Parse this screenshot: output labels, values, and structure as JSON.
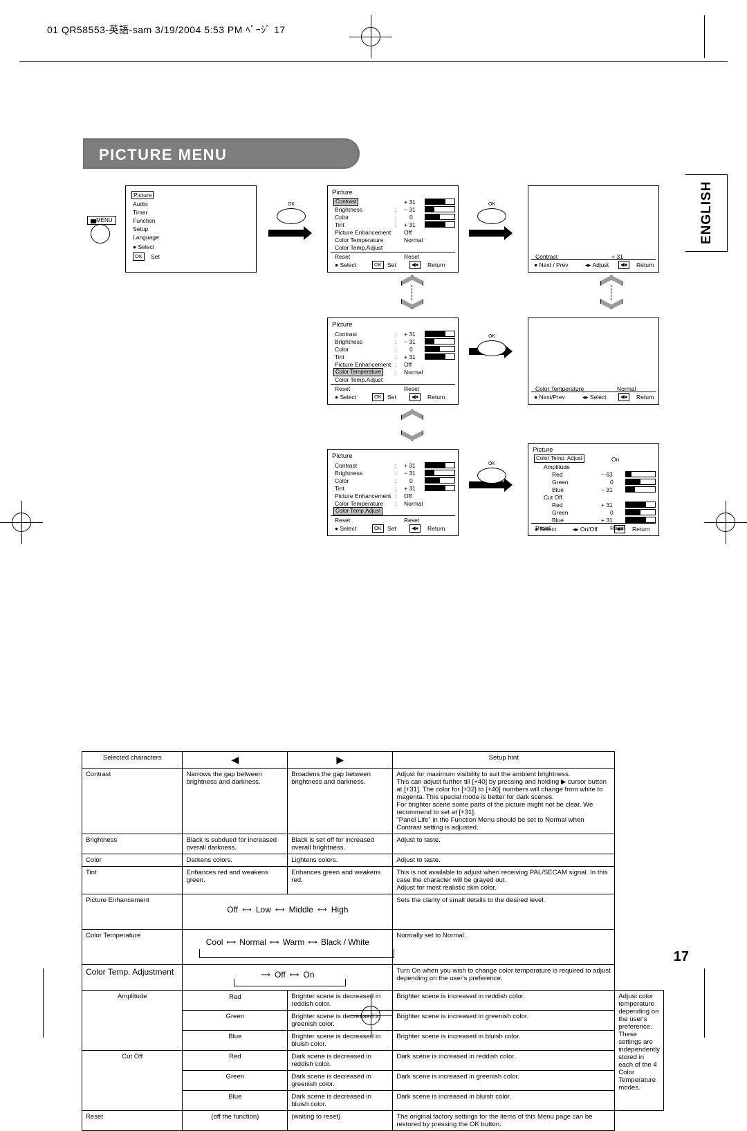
{
  "header": {
    "text": "01 QR58553-英語-sam 3/19/2004 5:53 PM ﾍﾟｰｼﾞ 17"
  },
  "title": "PICTURE MENU",
  "language_tab": "ENGLISH",
  "page_number": "17",
  "osd": {
    "menu_button_label": "MENU",
    "panel1": {
      "title": "Picture",
      "items": [
        "Picture",
        "Audio",
        "Timer",
        "Function",
        "Setup",
        "Language"
      ],
      "footer_select": "Select",
      "footer_ok": "OK",
      "footer_set": "Set"
    },
    "panel2": {
      "title": "Picture",
      "rows": [
        {
          "label": "Contrast",
          "value": "+ 31",
          "bar": 70,
          "highlight": true
        },
        {
          "label": "Brightness",
          "value": "− 31",
          "bar": 30
        },
        {
          "label": "Color",
          "value": "0",
          "bar": 50
        },
        {
          "label": "Tint",
          "value": "+ 31",
          "bar": 70
        },
        {
          "label": "Picture Enhancement",
          "value": "Off"
        },
        {
          "label": "Color Temperature",
          "value": "Normal"
        },
        {
          "label": "Color Temp.Adjust",
          "value": ""
        },
        {
          "label": "Reset",
          "value": "Reset"
        }
      ],
      "footer": [
        "Select",
        "OK",
        "Set",
        "Return"
      ]
    },
    "panel3": {
      "rows": [
        {
          "label": "Contrast",
          "value": "+ 31"
        }
      ],
      "footer": [
        "Next / Prev",
        "Adjust",
        "Return"
      ]
    },
    "panel4": {
      "title": "Picture",
      "rows": [
        {
          "label": "Contrast",
          "value": "+ 31",
          "bar": 70
        },
        {
          "label": "Brightness",
          "value": "− 31",
          "bar": 30
        },
        {
          "label": "Color",
          "value": "0",
          "bar": 50
        },
        {
          "label": "Tint",
          "value": "+ 31",
          "bar": 70
        },
        {
          "label": "Picture Enhancement",
          "value": "Off"
        },
        {
          "label": "Color Temperature",
          "value": "Normal",
          "highlight": true
        },
        {
          "label": "Color Temp.Adjust",
          "value": ""
        },
        {
          "label": "Reset",
          "value": "Reset"
        }
      ],
      "footer": [
        "Select",
        "OK",
        "Set",
        "Return"
      ]
    },
    "panel5": {
      "rows": [
        {
          "label": "Color Temperature",
          "value": "Normal"
        }
      ],
      "footer": [
        "Next/Prev",
        "Select",
        "Return"
      ]
    },
    "panel6": {
      "title": "Picture",
      "rows": [
        {
          "label": "Contrast",
          "value": "+ 31",
          "bar": 70
        },
        {
          "label": "Brightness",
          "value": "− 31",
          "bar": 30
        },
        {
          "label": "Color",
          "value": "0",
          "bar": 50
        },
        {
          "label": "Tint",
          "value": "+ 31",
          "bar": 70
        },
        {
          "label": "Picture Enhancement",
          "value": "Off"
        },
        {
          "label": "Color Temperature",
          "value": "Normal"
        },
        {
          "label": "Color Temp.Adjust",
          "value": "",
          "highlight": true
        },
        {
          "label": "Reset",
          "value": "Reset"
        }
      ],
      "footer": [
        "Select",
        "OK",
        "Set",
        "Return"
      ]
    },
    "panel7": {
      "title": "Picture",
      "head": {
        "label": "Color Temp. Adjust",
        "value": "On"
      },
      "group1": "Amplitude",
      "group1_rows": [
        {
          "label": "Red",
          "value": "− 63",
          "bar": 18
        },
        {
          "label": "Green",
          "value": "0",
          "bar": 50
        },
        {
          "label": "Blue",
          "value": "− 31",
          "bar": 32
        }
      ],
      "group2": "Cut Off",
      "group2_rows": [
        {
          "label": "Red",
          "value": "+ 31",
          "bar": 70
        },
        {
          "label": "Green",
          "value": "0",
          "bar": 50
        },
        {
          "label": "Blue",
          "value": "+ 31",
          "bar": 70
        }
      ],
      "reset_label": "Reset",
      "reset_value": "Reset",
      "footer": [
        "Select",
        "On/Off",
        "Return"
      ]
    }
  },
  "table": {
    "headers": [
      "Selected characters",
      "◀",
      "▶",
      "Setup hint"
    ],
    "rows": [
      {
        "name": "Contrast",
        "left": "Narrows the gap between brightness and darkness.",
        "right": "Broadens the gap between brightness and darkness.",
        "hint": "Adjust for maximum visibility to suit the ambient brightness.\nThis can adjust further till [+40] by pressing and holding ▶ cursor button at [+31]. The color for [+32] to [+40] numbers will change from white to magenta. This special mode is better for dark scenes.\nFor brighter scene some parts of the picture might not be clear. We recommend to set at [+31].\n\"Panel Life\" in the Function Menu should be set to Normal when Contrast setting is adjusted."
      },
      {
        "name": "Brightness",
        "left": "Black is subdued for increased overall darkness.",
        "right": "Black is set off for increased overall brightness.",
        "hint": "Adjust to taste."
      },
      {
        "name": "Color",
        "left": "Darkens colors.",
        "right": "Lightens colors.",
        "hint": "Adjust to taste."
      },
      {
        "name": "Tint",
        "left": "Enhances red and weakens green.",
        "right": "Enhances green and weakens red.",
        "hint": "This is not available to adjust when receiving PAL/SECAM signal. In this case the character will be grayed out.\nAdjust for most realistic skin color."
      },
      {
        "name": "Picture Enhancement",
        "flow": [
          "Off",
          "Low",
          "Middle",
          "High"
        ],
        "hint": "Sets the clarity of small details to the desired level."
      },
      {
        "name": "Color Temperature",
        "flow": [
          "Cool",
          "Normal",
          "Warm",
          "Black / White"
        ],
        "hint": "Normally set to Normal."
      },
      {
        "name": "Color Temp. Adjustment",
        "flow": [
          "Off",
          "On"
        ],
        "hint": "Turn On when you wish to change color temperature is required to adjust depending on the user's preference."
      }
    ],
    "amplitude_label": "Amplitude",
    "cutoff_label": "Cut Off",
    "color_rows": [
      {
        "color": "Red",
        "left": "Brighter scene is decreased in reddish color.",
        "right": "Brighter scene is increased in reddish color."
      },
      {
        "color": "Green",
        "left": "Brighter scene is decreased in greenish color.",
        "right": "Brighter scene is increased in greenish color."
      },
      {
        "color": "Blue",
        "left": "Brighter scene is decreased in bluish color.",
        "right": "Brighter scene is increased in bluish color."
      },
      {
        "color": "Red",
        "left": "Dark scene is decreased in reddish color.",
        "right": "Dark scene is increased in reddish color."
      },
      {
        "color": "Green",
        "left": "Dark scene is decreased in greenish color.",
        "right": "Dark scene is increased in greenish color."
      },
      {
        "color": "Blue",
        "left": "Dark scene is decreased in bluish color.",
        "right": "Dark scene is increased in bluish color."
      }
    ],
    "color_hint": "Adjust color temperature depending on the user's preference. These settings are independently stored in each of the 4 Color Temperature modes.",
    "reset_row": {
      "name": "Reset",
      "left": "(off the function)",
      "right": "(waiting to reset)",
      "hint": "The original factory settings for the items of this Menu page can be restored by pressing the OK button."
    }
  }
}
